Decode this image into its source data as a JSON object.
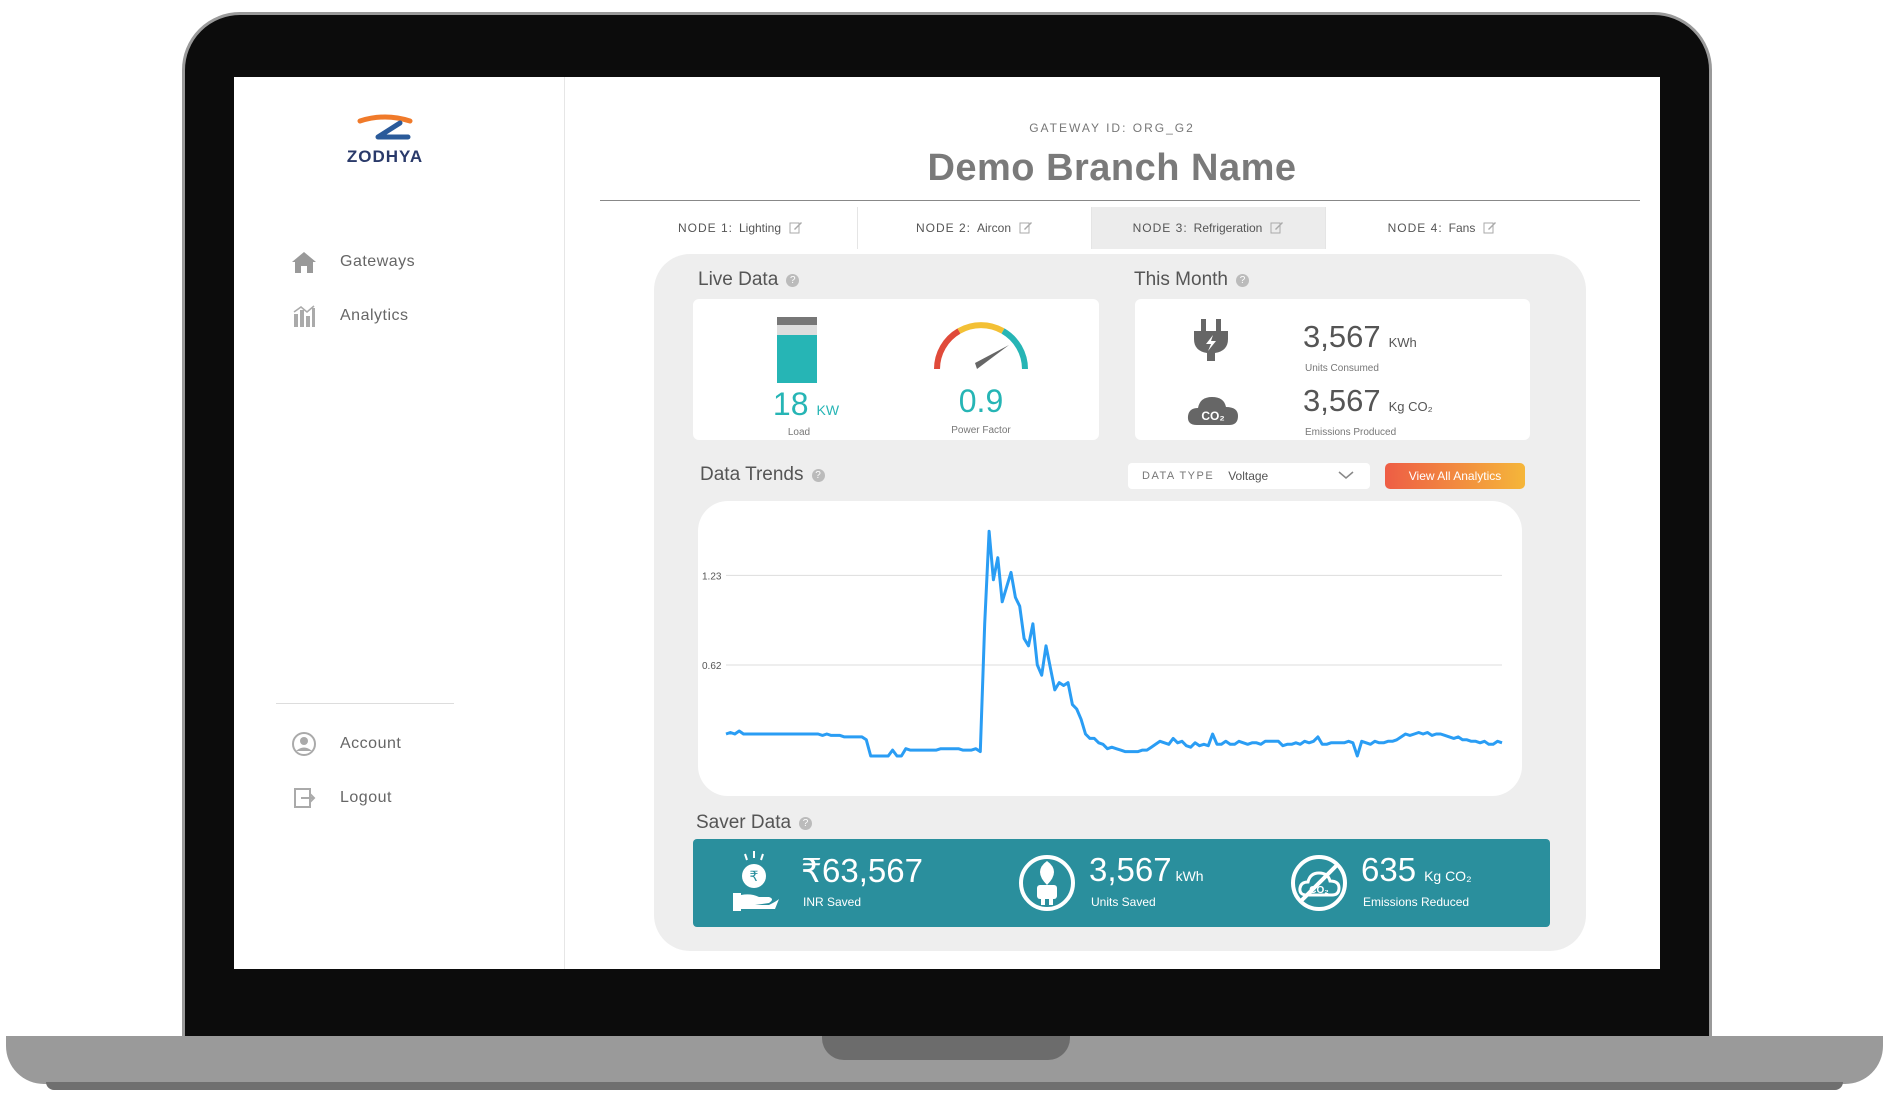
{
  "sidebar": {
    "logo_text": "ZODHYA",
    "nav": [
      {
        "label": "Gateways",
        "icon": "home-icon"
      },
      {
        "label": "Analytics",
        "icon": "bar-chart-icon"
      }
    ],
    "bottom": [
      {
        "label": "Account",
        "icon": "user-icon"
      },
      {
        "label": "Logout",
        "icon": "logout-icon"
      }
    ]
  },
  "header": {
    "gateway_id": "GATEWAY ID: ORG_G2",
    "branch_name": "Demo Branch Name"
  },
  "tabs": [
    {
      "prefix": "NODE 1:",
      "name": "Lighting",
      "active": false
    },
    {
      "prefix": "NODE 2:",
      "name": "Aircon",
      "active": false
    },
    {
      "prefix": "NODE 3:",
      "name": "Refrigeration",
      "active": true
    },
    {
      "prefix": "NODE 4:",
      "name": "Fans",
      "active": false
    }
  ],
  "live_data": {
    "title": "Live Data",
    "load_value": "18",
    "load_unit": "KW",
    "load_label": "Load",
    "load_fill_fraction": 0.82,
    "pf_value": "0.9",
    "pf_label": "Power Factor",
    "pf_fraction": 0.9
  },
  "this_month": {
    "title": "This Month",
    "units_value": "3,567",
    "units_unit": "KWh",
    "units_label": "Units Consumed",
    "emis_value": "3,567",
    "emis_unit": "Kg CO₂",
    "emis_label": "Emissions Produced"
  },
  "trends": {
    "title": "Data Trends",
    "data_type_label": "DATA TYPE",
    "data_type_value": "Voltage",
    "button_label": "View All Analytics"
  },
  "chart_data": {
    "type": "line",
    "title": "",
    "xlabel": "",
    "ylabel": "",
    "y_ticks": [
      "1.23",
      "0.62"
    ],
    "ylim": [
      0.0,
      1.6
    ],
    "grid": true,
    "color": "#2a9df4",
    "series": [
      {
        "values": [
          0.15,
          0.16,
          0.15,
          0.17,
          0.15,
          0.15,
          0.15,
          0.15,
          0.15,
          0.15,
          0.15,
          0.15,
          0.15,
          0.15,
          0.15,
          0.15,
          0.15,
          0.15,
          0.15,
          0.15,
          0.15,
          0.15,
          0.14,
          0.15,
          0.14,
          0.14,
          0.14,
          0.13,
          0.13,
          0.13,
          0.13,
          0.13,
          0.11,
          0.0,
          0.0,
          0.0,
          0.0,
          0.0,
          0.04,
          0.0,
          0.0,
          0.05,
          0.04,
          0.04,
          0.04,
          0.04,
          0.04,
          0.04,
          0.04,
          0.05,
          0.05,
          0.05,
          0.05,
          0.05,
          0.04,
          0.04,
          0.04,
          0.05,
          0.03,
          0.9,
          1.53,
          1.2,
          1.35,
          1.05,
          1.15,
          1.25,
          1.08,
          1.02,
          0.8,
          0.75,
          0.9,
          0.62,
          0.55,
          0.75,
          0.6,
          0.45,
          0.5,
          0.48,
          0.5,
          0.35,
          0.32,
          0.25,
          0.15,
          0.12,
          0.12,
          0.09,
          0.08,
          0.05,
          0.06,
          0.05,
          0.04,
          0.03,
          0.03,
          0.03,
          0.03,
          0.04,
          0.04,
          0.06,
          0.08,
          0.1,
          0.09,
          0.08,
          0.12,
          0.09,
          0.1,
          0.07,
          0.06,
          0.09,
          0.07,
          0.08,
          0.07,
          0.15,
          0.08,
          0.08,
          0.1,
          0.08,
          0.08,
          0.1,
          0.09,
          0.08,
          0.09,
          0.09,
          0.08,
          0.1,
          0.1,
          0.1,
          0.1,
          0.07,
          0.08,
          0.08,
          0.09,
          0.08,
          0.1,
          0.09,
          0.1,
          0.13,
          0.08,
          0.08,
          0.09,
          0.09,
          0.09,
          0.09,
          0.1,
          0.09,
          0.0,
          0.1,
          0.09,
          0.08,
          0.1,
          0.09,
          0.09,
          0.1,
          0.1,
          0.11,
          0.13,
          0.15,
          0.14,
          0.15,
          0.16,
          0.15,
          0.16,
          0.14,
          0.15,
          0.15,
          0.14,
          0.13,
          0.12,
          0.13,
          0.11,
          0.11,
          0.1,
          0.1,
          0.09,
          0.1,
          0.08,
          0.08,
          0.1,
          0.09
        ]
      }
    ]
  },
  "saver": {
    "title": "Saver Data",
    "inr_value": "₹63,567",
    "inr_label": "INR Saved",
    "units_value": "3,567",
    "units_unit": "kWh",
    "units_label": "Units Saved",
    "emis_value": "635",
    "emis_unit": "Kg CO₂",
    "emis_label": "Emissions Reduced"
  },
  "colors": {
    "teal": "#26b5b5",
    "saver_bg": "#2a8f9d",
    "line": "#2a9df4",
    "button_start": "#ee5d45",
    "button_end": "#f5b63a"
  }
}
